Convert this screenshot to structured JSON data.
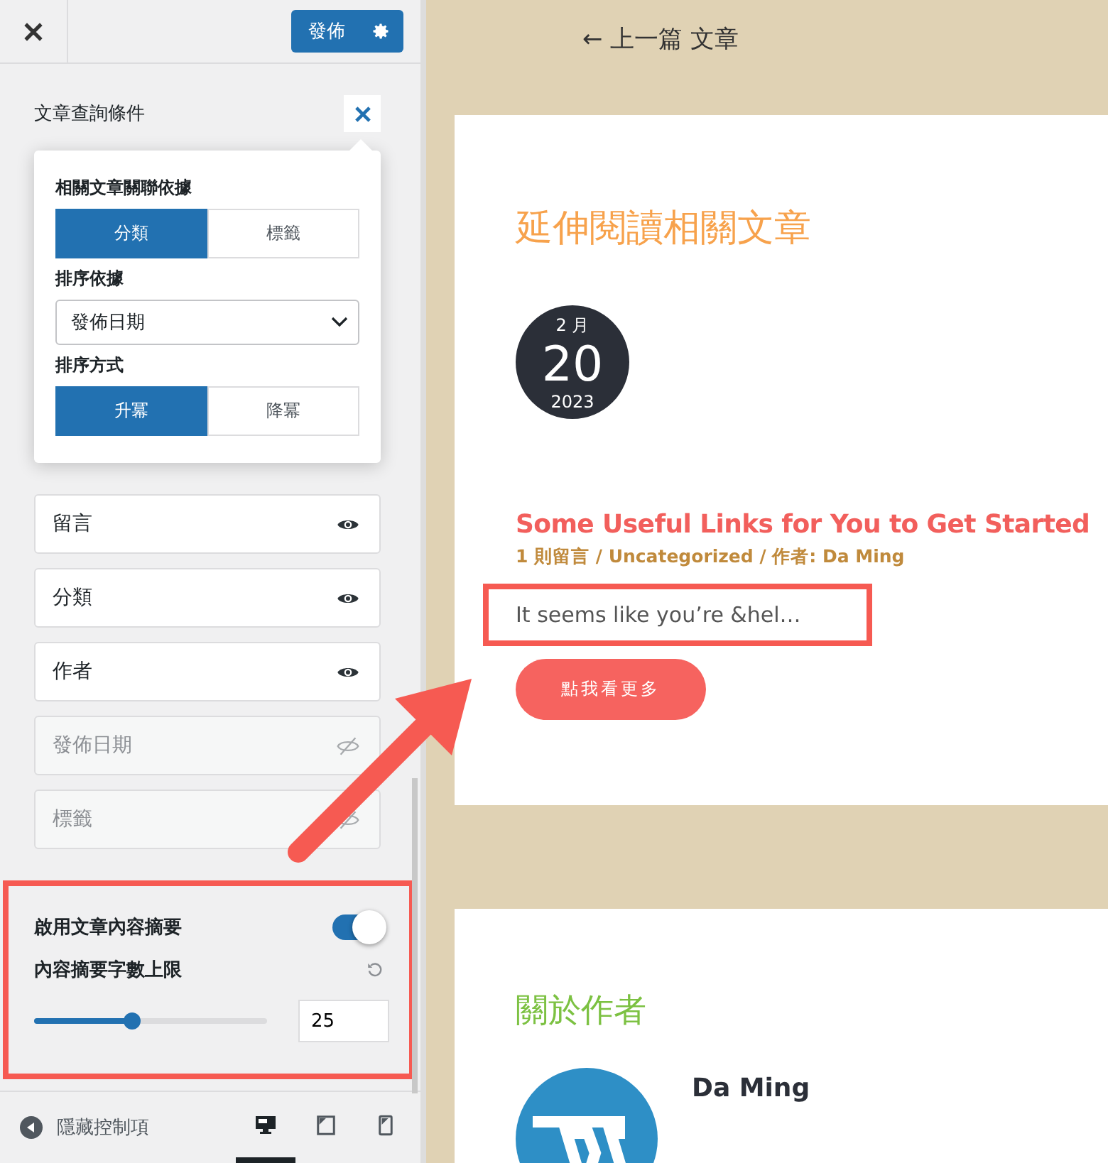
{
  "sidebar": {
    "publish_button": "發佈",
    "section_title": "文章查詢條件",
    "popover": {
      "relation_label": "相關文章關聯依據",
      "relation_options": [
        {
          "label": "分類",
          "selected": true
        },
        {
          "label": "標籤",
          "selected": false
        }
      ],
      "order_by_label": "排序依據",
      "order_by_value": "發佈日期",
      "order_label": "排序方式",
      "order_options": [
        {
          "label": "升冪",
          "selected": true
        },
        {
          "label": "降冪",
          "selected": false
        }
      ]
    },
    "meta_items": [
      {
        "label": "留言",
        "visible": true
      },
      {
        "label": "分類",
        "visible": true
      },
      {
        "label": "作者",
        "visible": true
      },
      {
        "label": "發佈日期",
        "visible": false
      },
      {
        "label": "標籤",
        "visible": false
      }
    ],
    "excerpt_toggle": {
      "label": "啟用文章內容摘要",
      "on": true
    },
    "excerpt_length": {
      "label": "內容摘要字數上限",
      "level": 0.42,
      "value": "25"
    },
    "footer": {
      "hide_label": "隱藏控制項",
      "devices": [
        {
          "kind": "desktop",
          "selected": true
        },
        {
          "kind": "tablet",
          "selected": false
        },
        {
          "kind": "mobile",
          "selected": false
        }
      ]
    }
  },
  "preview": {
    "prev_link": "← 上一篇 文章",
    "related_heading": "延伸閱讀相關文章",
    "date": {
      "month": "2 月",
      "day": "20",
      "year": "2023"
    },
    "post_title": "Some Useful Links for You to Get Started",
    "post_meta": "1 則留言 / Uncategorized / 作者: Da Ming",
    "excerpt": "It seems like you’re &hel…",
    "read_more": "點我看更多",
    "author_heading": "關於作者",
    "author_name": "Da Ming"
  }
}
